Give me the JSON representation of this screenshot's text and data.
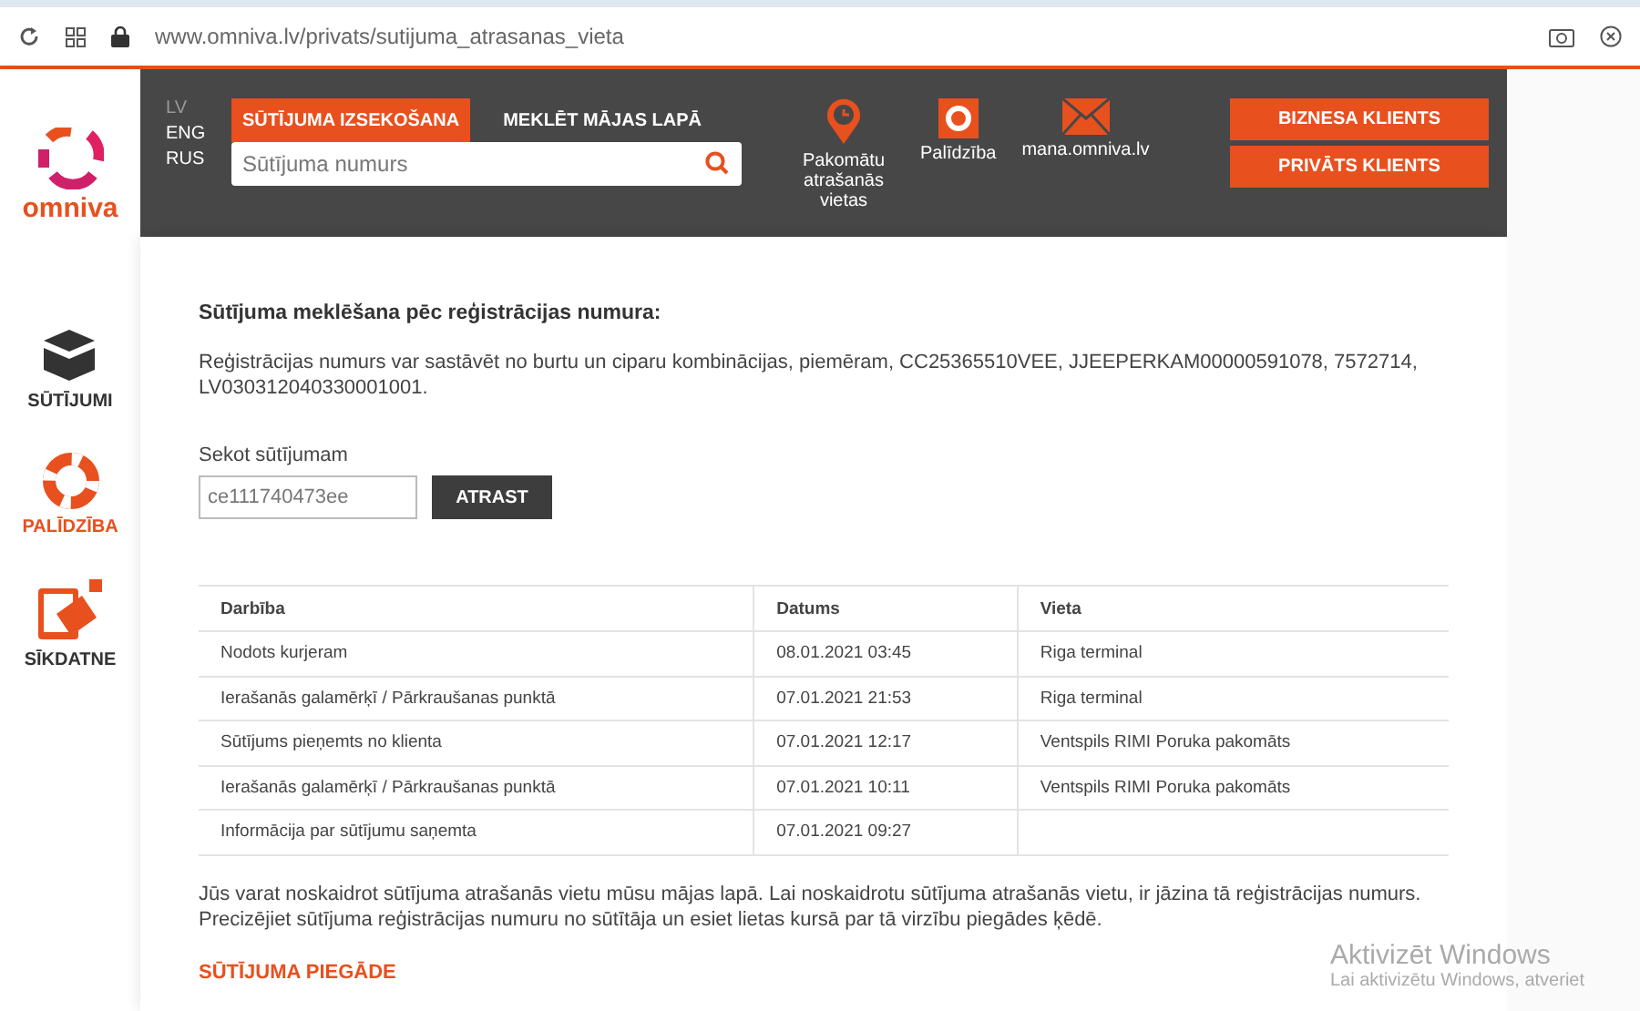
{
  "browser": {
    "url": "www.omniva.lv/privats/sutijuma_atrasanas_vieta"
  },
  "sidebar": {
    "logo": "omniva",
    "items": [
      {
        "kind": "box",
        "label": "SŪTĪJUMI",
        "selected": false
      },
      {
        "kind": "help",
        "label": "PALĪDZĪBA",
        "selected": true
      },
      {
        "kind": "cookie",
        "label": "SĪKDATNE",
        "selected": false
      }
    ]
  },
  "header": {
    "languages": [
      {
        "label": "LV",
        "selected": true
      },
      {
        "label": "ENG",
        "selected": false
      },
      {
        "label": "RUS",
        "selected": false
      }
    ],
    "tabs": [
      {
        "label": "SŪTĪJUMA IZSEKOŠANA",
        "selected": true
      },
      {
        "label": "MEKLĒT MĀJAS LAPĀ",
        "selected": false
      }
    ],
    "search": {
      "placeholder": "Sūtījuma numurs"
    },
    "links": [
      {
        "kind": "pin",
        "label": "Pakomātu atrašanās vietas"
      },
      {
        "kind": "help",
        "label": "Palīdzība"
      },
      {
        "kind": "mail",
        "label": "mana.omniva.lv"
      }
    ],
    "buttons": [
      "BIZNESA KLIENTS",
      "PRIVĀTS KLIENTS"
    ]
  },
  "content": {
    "heading": "Sūtījuma meklēšana pēc reģistrācijas numura:",
    "intro": "Reģistrācijas numurs var sastāvēt no burtu un ciparu kombinācijas, piemēram, CC25365510VEE, JJEEPERKAM00000591078, 7572714, LV030312040330001001.",
    "track_label": "Sekot sūtījumam",
    "track_value": "ce111740473ee",
    "track_button": "ATRAST",
    "table": {
      "columns": [
        "Darbība",
        "Datums",
        "Vieta"
      ],
      "rows": [
        [
          "Nodots kurjeram",
          "08.01.2021 03:45",
          "Riga terminal"
        ],
        [
          "Ierašanās galamērķī / Pārkraušanas punktā",
          "07.01.2021 21:53",
          "Riga terminal"
        ],
        [
          "Sūtījums pieņemts no klienta",
          "07.01.2021 12:17",
          "Ventspils RIMI Poruka pakomāts"
        ],
        [
          "Ierašanās galamērķī / Pārkraušanas punktā",
          "07.01.2021 10:11",
          "Ventspils RIMI Poruka pakomāts"
        ],
        [
          "Informācija par sūtījumu saņemta",
          "07.01.2021 09:27"
        ]
      ]
    },
    "note": "Jūs varat noskaidrot sūtījuma atrašanās vietu mūsu mājas lapā. Lai noskaidrotu sūtījuma atrašanās vietu, ir jāzina tā reģistrācijas numurs. Precizējiet sūtījuma reģistrācijas numuru no sūtītāja un esiet lietas kursā par tā virzību piegādes ķēdē.",
    "section_title": "SŪTĪJUMA PIEGĀDE"
  },
  "os_notice": {
    "title": "Aktivizēt Windows",
    "text": "Lai aktivizētu Windows, atveriet"
  }
}
